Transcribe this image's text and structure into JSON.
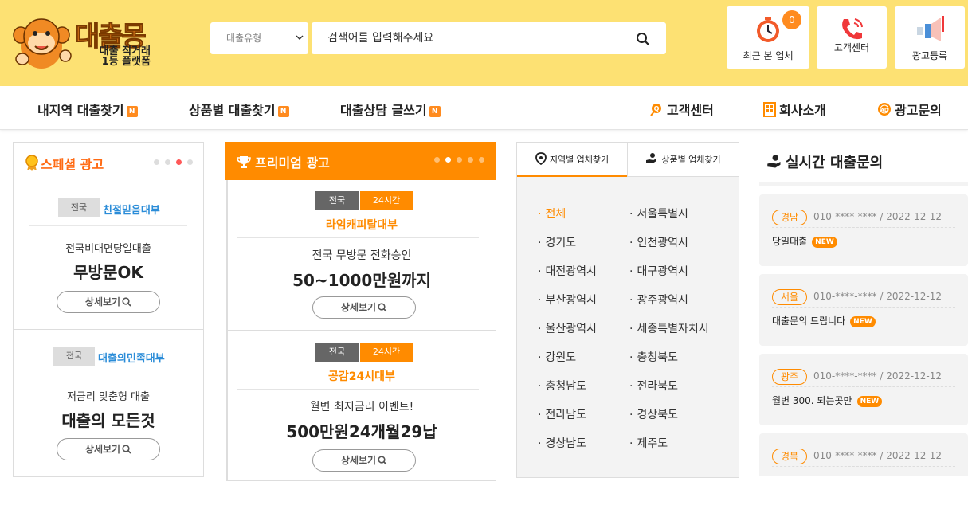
{
  "brand": {
    "title": "대출몽",
    "sub_line1": "대출 직거래",
    "sub_line2": "1등 플랫폼"
  },
  "search": {
    "type_select": "대출유형",
    "placeholder": "검색어를 입력해주세요"
  },
  "header_buttons": {
    "recent": "최근 본 업체",
    "recent_count": "0",
    "support": "고객센터",
    "ad_register": "광고등록"
  },
  "nav": {
    "left": [
      {
        "label": "내지역 대출찾기",
        "badge": "N"
      },
      {
        "label": "상품별 대출찾기",
        "badge": "N"
      },
      {
        "label": "대출상담 글쓰기",
        "badge": "N"
      }
    ],
    "right": [
      {
        "label": "고객센터",
        "icon": "headset-icon"
      },
      {
        "label": "회사소개",
        "icon": "building-icon"
      },
      {
        "label": "광고문의",
        "icon": "ad-gear-icon"
      }
    ]
  },
  "special": {
    "title": "스페셜 광고",
    "cards": [
      {
        "area": "전국",
        "name": "친절믿음대부",
        "desc": "전국비대면당일대출",
        "headline": "무방문OK",
        "button": "상세보기"
      },
      {
        "area": "전국",
        "name": "대출의민족대부",
        "desc": "저금리 맞춤형 대출",
        "headline": "대출의 모든것",
        "button": "상세보기"
      }
    ]
  },
  "premium": {
    "title": "프리미엄 광고",
    "cards": [
      {
        "area": "전국",
        "hours": "24시간",
        "name": "라임캐피탈대부",
        "desc": "전국 무방문 전화승인",
        "headline": "50~1000만원까지",
        "button": "상세보기"
      },
      {
        "area": "전국",
        "hours": "24시간",
        "name": "공감24시대부",
        "desc": "월변 최저금리 이벤트!",
        "headline": "500만원24개월29납",
        "button": "상세보기"
      }
    ]
  },
  "finder": {
    "tab_region": "지역별 업체찾기",
    "tab_product": "상품별 업체찾기",
    "regions_left": [
      "전체",
      "경기도",
      "대전광역시",
      "부산광역시",
      "울산광역시",
      "강원도",
      "충청남도",
      "전라남도",
      "경상남도"
    ],
    "regions_right": [
      "서울특별시",
      "인천광역시",
      "대구광역시",
      "광주광역시",
      "세종특별자치시",
      "충청북도",
      "전라북도",
      "경상북도",
      "제주도"
    ]
  },
  "realtime": {
    "title": "실시간 대출문의",
    "items": [
      {
        "region": "경남",
        "meta": "010-****-**** / 2022-12-12",
        "message": "당일대출",
        "badge": "NEW"
      },
      {
        "region": "서울",
        "meta": "010-****-**** / 2022-12-12",
        "message": "대출문의 드립니다",
        "badge": "NEW"
      },
      {
        "region": "광주",
        "meta": "010-****-**** / 2022-12-12",
        "message": "월변 300. 되는곳만",
        "badge": "NEW"
      },
      {
        "region": "경북",
        "meta": "010-****-**** / 2022-12-12",
        "message": "",
        "badge": ""
      }
    ]
  },
  "colors": {
    "header_bg": "#fde173",
    "accent_orange": "#ff8b00",
    "special_title": "#ff6a13",
    "company_blue": "#2a8cd8"
  }
}
